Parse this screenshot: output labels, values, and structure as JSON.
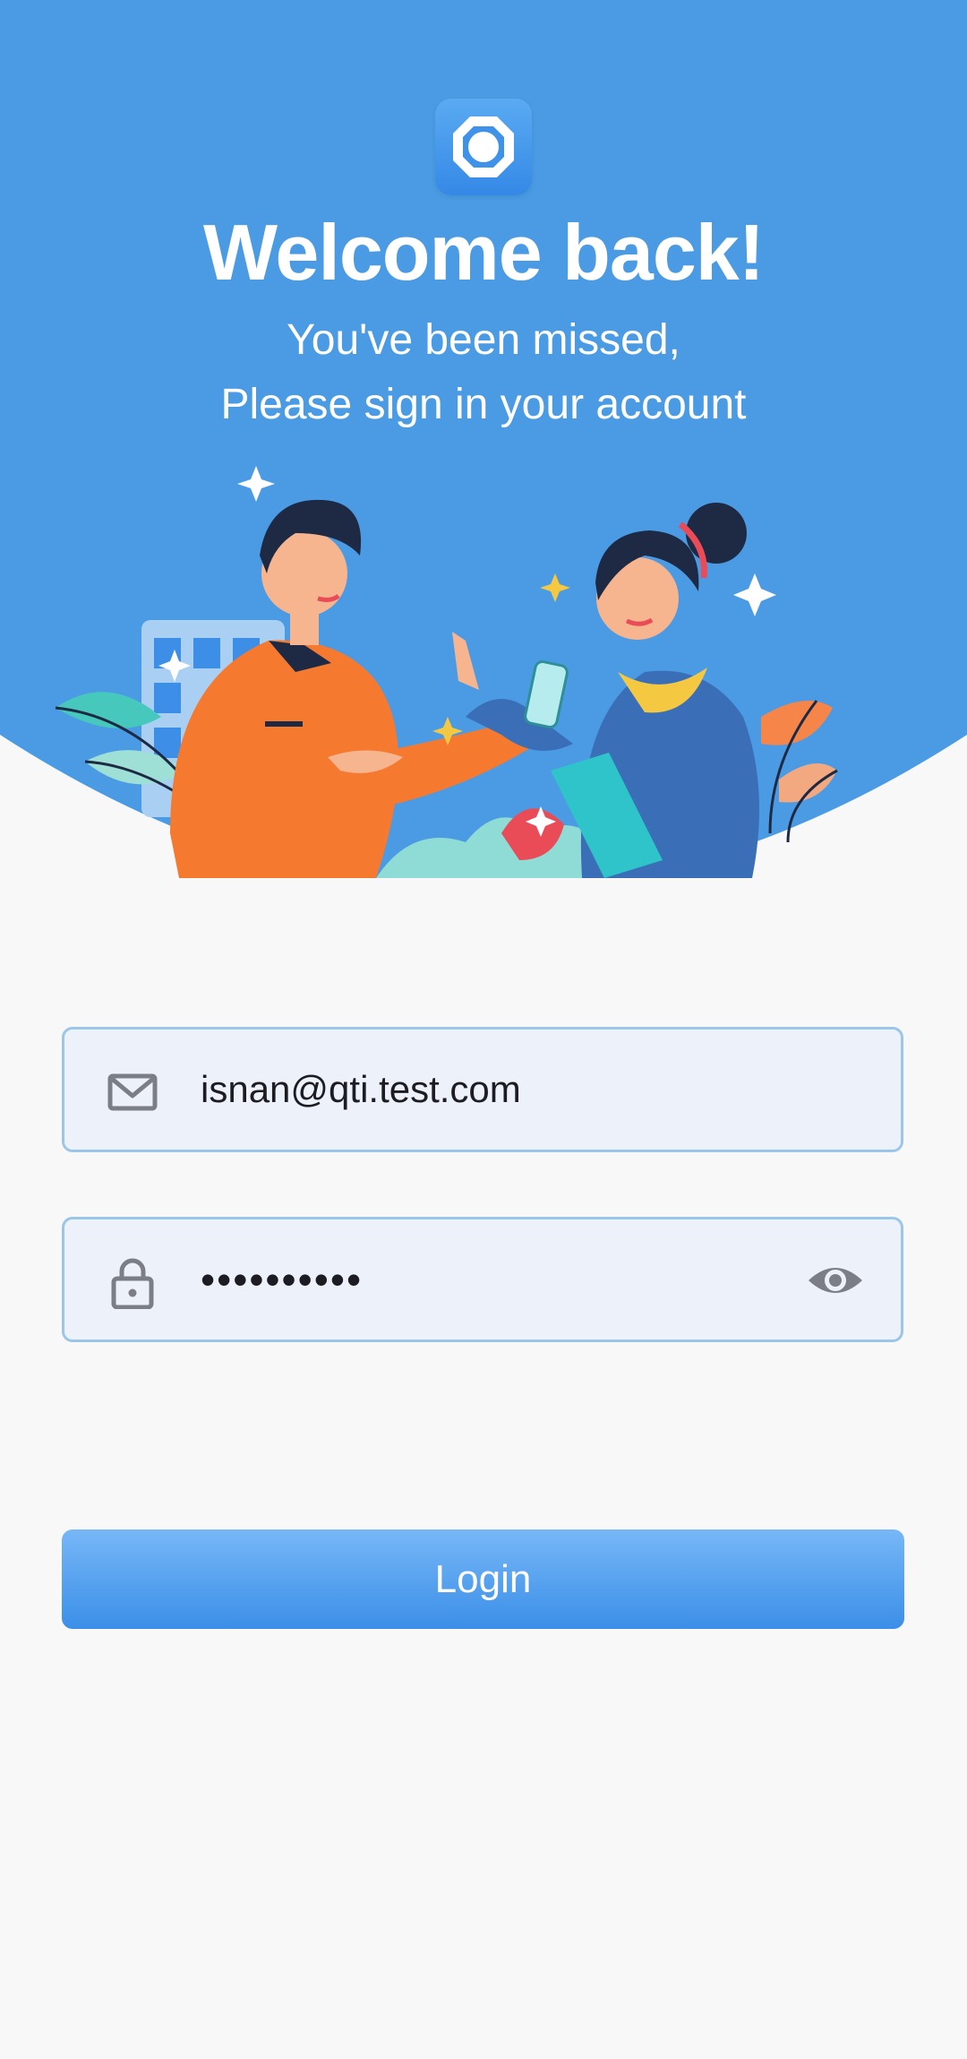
{
  "header": {
    "logo_icon": "octagon-ring-logo-icon",
    "title": "Welcome back!",
    "subtitle_line1": "You've been missed,",
    "subtitle_line2": "Please sign in your account"
  },
  "form": {
    "email": {
      "icon": "mail-icon",
      "value": "isnan@qti.test.com"
    },
    "password": {
      "icon": "lock-icon",
      "value": "••••••••••",
      "toggle_icon": "eye-icon"
    },
    "login_label": "Login"
  },
  "colors": {
    "hero_blue": "#4a9be4",
    "button_top": "#77b7f7",
    "button_bottom": "#3b8fe8",
    "field_bg": "#edf2fa",
    "field_border": "#9cc6e8",
    "page_bg": "#f8f8f9"
  }
}
